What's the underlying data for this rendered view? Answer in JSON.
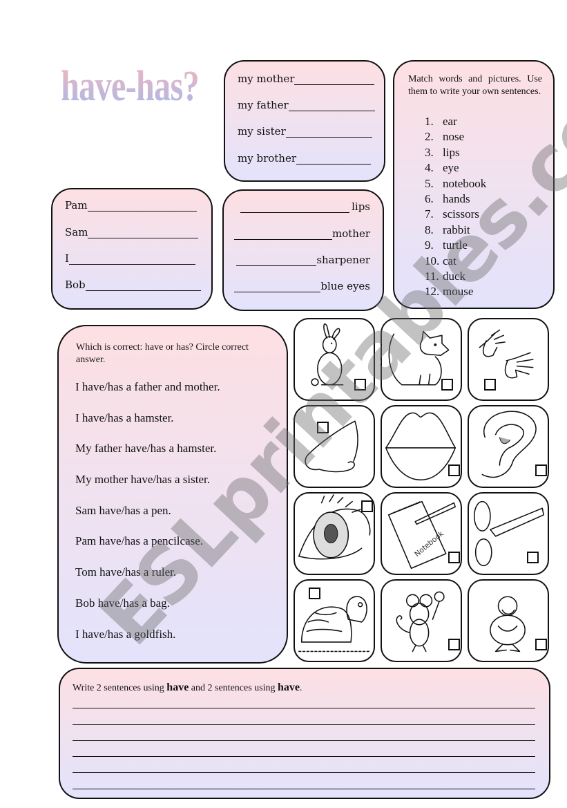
{
  "title": "have-has?",
  "family_box": {
    "items": [
      "my mother",
      "my father",
      "my sister",
      "my brother"
    ]
  },
  "names_box": {
    "items": [
      "Pam",
      "Sam",
      "I",
      "Bob"
    ]
  },
  "objects_box": {
    "items": [
      "lips",
      "mother",
      "sharpener",
      "blue eyes"
    ]
  },
  "match_box": {
    "instruction": "Match words and pictures. Use them to write your own sentences.",
    "items": [
      {
        "num": "1.",
        "word": "ear"
      },
      {
        "num": "2.",
        "word": "nose"
      },
      {
        "num": "3.",
        "word": "lips"
      },
      {
        "num": "4.",
        "word": "eye"
      },
      {
        "num": "5.",
        "word": "notebook"
      },
      {
        "num": "6.",
        "word": "hands"
      },
      {
        "num": "7.",
        "word": "scissors"
      },
      {
        "num": "8.",
        "word": "rabbit"
      },
      {
        "num": "9.",
        "word": "turtle"
      },
      {
        "num": "10.",
        "word": "cat"
      },
      {
        "num": "11.",
        "word": "duck"
      },
      {
        "num": "12.",
        "word": "mouse"
      }
    ]
  },
  "circle_box": {
    "instruction": "Which is correct: have or has? Circle correct answer.",
    "sentences": [
      "I have/has a father and mother.",
      "I have/has a hamster.",
      "My father have/has a hamster.",
      "My mother have/has a sister.",
      "Sam have/has a pen.",
      "Pam have/has a pencilcase.",
      "Tom have/has a ruler.",
      "Bob have/has a bag.",
      "I have/has a goldfish."
    ]
  },
  "pictures": [
    {
      "name": "rabbit",
      "icon": "rabbit-icon"
    },
    {
      "name": "cat",
      "icon": "cat-icon"
    },
    {
      "name": "hands",
      "icon": "hands-icon"
    },
    {
      "name": "nose",
      "icon": "nose-icon"
    },
    {
      "name": "lips",
      "icon": "lips-icon"
    },
    {
      "name": "ear",
      "icon": "ear-icon"
    },
    {
      "name": "eye",
      "icon": "eye-icon"
    },
    {
      "name": "notebook",
      "icon": "notebook-icon",
      "label": "Notebook"
    },
    {
      "name": "scissors",
      "icon": "scissors-icon"
    },
    {
      "name": "turtle",
      "icon": "turtle-icon"
    },
    {
      "name": "mouse",
      "icon": "mouse-icon"
    },
    {
      "name": "duck",
      "icon": "duck-icon"
    }
  ],
  "write_box": {
    "text_before": "Write 2 sentences using ",
    "bold1": "have",
    "text_middle": " and 2 sentences using ",
    "bold2": "have",
    "text_after": ".",
    "line_count": 6
  },
  "watermark": "ESLprintables.com",
  "colors": {
    "box_top": "#fde0e3",
    "box_bottom": "#e3e3fc",
    "title_top": "#f2b6c0",
    "title_bottom": "#a9b8e6"
  }
}
